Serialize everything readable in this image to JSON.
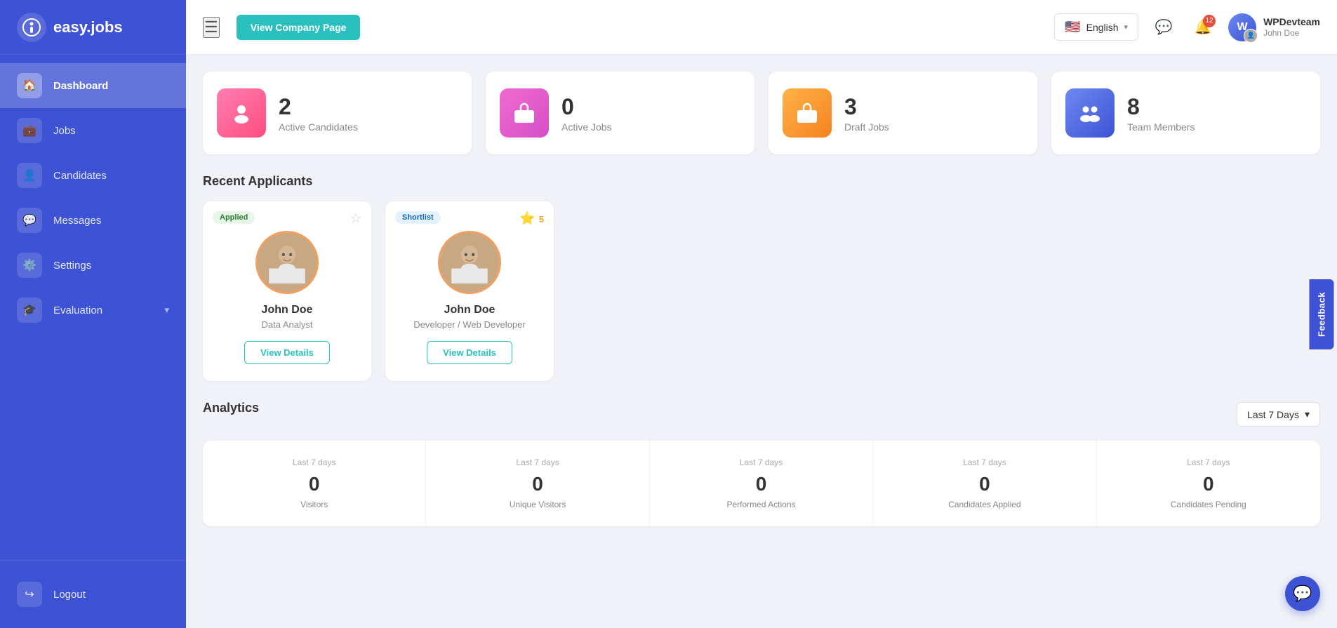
{
  "app": {
    "name": "easy.jobs",
    "logo_char": "i"
  },
  "sidebar": {
    "items": [
      {
        "id": "dashboard",
        "label": "Dashboard",
        "icon": "🏠",
        "active": true
      },
      {
        "id": "jobs",
        "label": "Jobs",
        "icon": "💼",
        "active": false
      },
      {
        "id": "candidates",
        "label": "Candidates",
        "icon": "👤",
        "active": false
      },
      {
        "id": "messages",
        "label": "Messages",
        "icon": "💬",
        "active": false
      },
      {
        "id": "settings",
        "label": "Settings",
        "icon": "⚙️",
        "active": false
      },
      {
        "id": "evaluation",
        "label": "Evaluation",
        "icon": "🎓",
        "active": false,
        "has_chevron": true
      }
    ],
    "logout_label": "Logout"
  },
  "header": {
    "view_company_label": "View Company Page",
    "language": "English",
    "notification_count": "12",
    "user": {
      "company": "WPDevteam",
      "name": "John Doe",
      "initials": "W"
    }
  },
  "stats": [
    {
      "id": "active-candidates",
      "number": "2",
      "label": "Active Candidates",
      "icon_type": "pink",
      "icon": "👤"
    },
    {
      "id": "active-jobs",
      "number": "0",
      "label": "Active Jobs",
      "icon_type": "magenta",
      "icon": "💼"
    },
    {
      "id": "draft-jobs",
      "number": "3",
      "label": "Draft Jobs",
      "icon_type": "orange",
      "icon": "💼"
    },
    {
      "id": "team-members",
      "number": "8",
      "label": "Team Members",
      "icon_type": "blue",
      "icon": "👥"
    }
  ],
  "recent_applicants": {
    "title": "Recent Applicants",
    "applicants": [
      {
        "id": "applicant-1",
        "badge": "Applied",
        "badge_type": "applied",
        "name": "John Doe",
        "role": "Data Analyst",
        "starred": false,
        "star_count": null,
        "view_details_label": "View Details"
      },
      {
        "id": "applicant-2",
        "badge": "Shortlist",
        "badge_type": "shortlist",
        "name": "John Doe",
        "role": "Developer / Web Developer",
        "starred": true,
        "star_count": "5",
        "view_details_label": "View Details"
      }
    ]
  },
  "analytics": {
    "title": "Analytics",
    "period_label": "Last 7 Days",
    "stats": [
      {
        "id": "visitors",
        "period": "Last 7 days",
        "number": "0",
        "label": "Visitors"
      },
      {
        "id": "unique-visitors",
        "period": "Last 7 days",
        "number": "0",
        "label": "Unique Visitors"
      },
      {
        "id": "performed-actions",
        "period": "Last 7 days",
        "number": "0",
        "label": "Performed Actions"
      },
      {
        "id": "candidates-applied",
        "period": "Last 7 days",
        "number": "0",
        "label": "Candidates Applied"
      },
      {
        "id": "candidates-pending",
        "period": "Last 7 days",
        "number": "0",
        "label": "Candidates Pending"
      }
    ]
  },
  "feedback": {
    "label": "Feedback"
  },
  "chat": {
    "icon": "💬"
  }
}
